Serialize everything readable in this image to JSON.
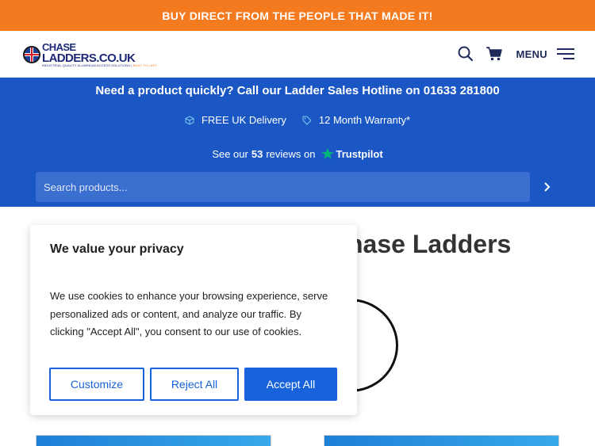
{
  "promo_banner": "BUY DIRECT FROM THE PEOPLE THAT MADE IT!",
  "header": {
    "logo_line1": "CHASE",
    "logo_line2": "LADDERS.CO.UK",
    "logo_tagline": "INDUSTRIAL QUALITY ALUMINIUM ACCESS SOLUTIONS",
    "logo_tagline_accent": "BUILT TO LAST",
    "menu_label": "MENU",
    "icons": [
      "search-icon",
      "cart-icon",
      "hamburger-icon"
    ]
  },
  "hero": {
    "hotline": "Need a product quickly? Call our Ladder Sales Hotline on 01633 281800",
    "features": [
      {
        "icon": "box-icon",
        "label": "FREE UK Delivery"
      },
      {
        "icon": "tag-icon",
        "label": "12 Month Warranty*"
      }
    ],
    "reviews_prefix": "See our",
    "reviews_count": "53",
    "reviews_suffix": "reviews on",
    "trustpilot": "Trustpilot",
    "search_placeholder": "Search products..."
  },
  "page": {
    "heading": "hase Ladders"
  },
  "cookie_banner": {
    "title": "We value your privacy",
    "text": "We use cookies to enhance your browsing experience, serve personalized ads or content, and analyze our traffic. By clicking \"Accept All\", you consent to our use of cookies.",
    "customize": "Customize",
    "reject": "Reject All",
    "accept": "Accept All"
  },
  "colors": {
    "promo": "#f47a1f",
    "hero": "#1a56c4",
    "button_primary": "#1863dc",
    "trustpilot_star": "#00b67a"
  }
}
